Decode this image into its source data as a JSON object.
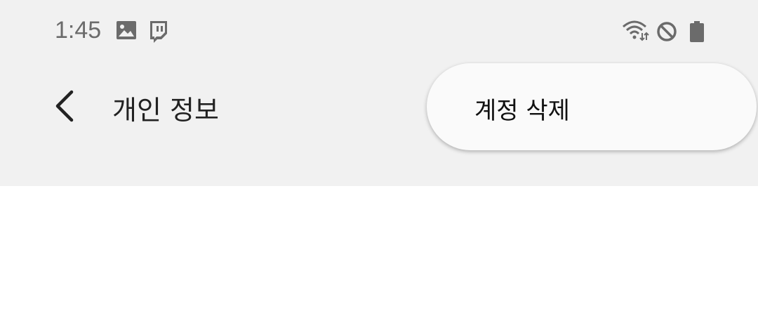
{
  "status_bar": {
    "time": "1:45",
    "icons": [
      "gallery-icon",
      "twitch-icon",
      "wifi-icon",
      "do-not-disturb-icon",
      "battery-icon"
    ]
  },
  "app_bar": {
    "back_icon": "chevron-left-icon",
    "title": "개인 정보"
  },
  "popup_menu": {
    "items": [
      {
        "label": "계정 삭제"
      }
    ]
  },
  "colors": {
    "topbar_bg": "#f1f1f1",
    "menu_bg": "#fafafa",
    "content_bg": "#ffffff"
  }
}
